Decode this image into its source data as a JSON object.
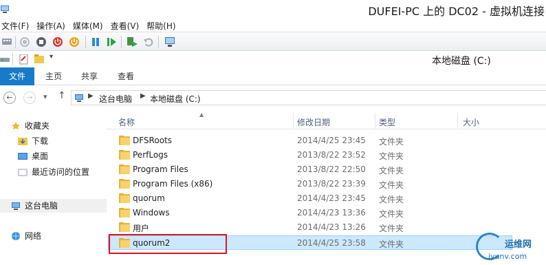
{
  "vm_window": {
    "title": "DUFEI-PC 上的 DC02 - 虚拟机连接",
    "menu": [
      "文件(F)",
      "操作(A)",
      "媒体(M)",
      "查看(V)",
      "帮助(H)"
    ]
  },
  "explorer": {
    "title": "本地磁盘 (C:)",
    "ribbon_tabs": [
      "文件",
      "主页",
      "共享",
      "查看"
    ],
    "breadcrumb": [
      "这台电脑",
      "本地磁盘 (C:)"
    ],
    "nav_pane": {
      "favorites": "收藏夹",
      "favorite_items": [
        "下载",
        "桌面",
        "最近访问的位置"
      ],
      "this_pc": "这台电脑",
      "network": "网络"
    },
    "columns": [
      "名称",
      "修改日期",
      "类型",
      "大小"
    ],
    "files": [
      {
        "name": "DFSRoots",
        "date": "2014/4/25 23:45",
        "type": "文件夹"
      },
      {
        "name": "PerfLogs",
        "date": "2013/8/22 23:52",
        "type": "文件夹"
      },
      {
        "name": "Program Files",
        "date": "2013/8/22 22:50",
        "type": "文件夹"
      },
      {
        "name": "Program Files (x86)",
        "date": "2013/8/22 23:39",
        "type": "文件夹"
      },
      {
        "name": "quorum",
        "date": "2014/4/23 23:45",
        "type": "文件夹"
      },
      {
        "name": "Windows",
        "date": "2014/4/23 13:36",
        "type": "文件夹"
      },
      {
        "name": "用户",
        "date": "2014/4/23 13:26",
        "type": "文件夹"
      },
      {
        "name": "quorum2",
        "date": "2014/4/25 23:58",
        "type": "文件夹",
        "selected": true
      }
    ]
  },
  "watermark": {
    "line1": "运维网",
    "line2": "iyunv.com"
  },
  "colors": {
    "accent": "#1979ca",
    "selection": "#cce8ff",
    "highlight_box": "#e3101c",
    "folder": "#f7d36b"
  }
}
